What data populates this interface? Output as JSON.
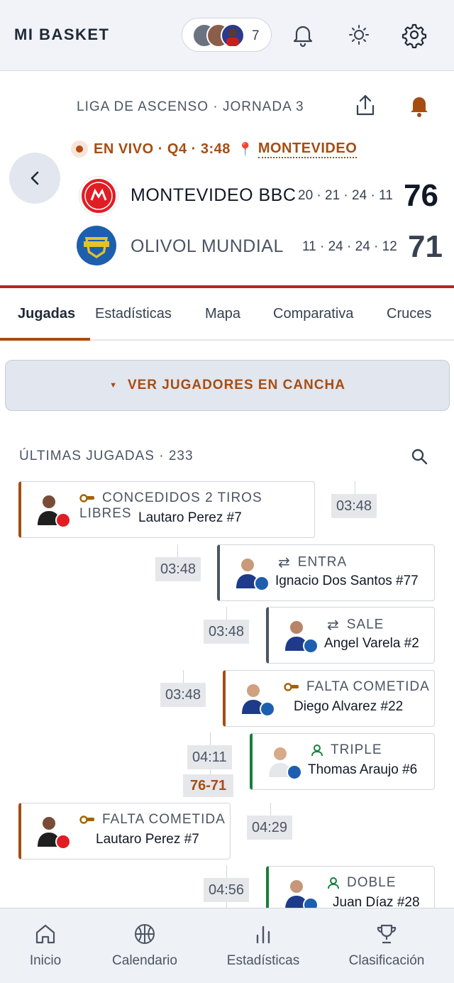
{
  "app": {
    "brand": "MI BASKET",
    "viewers_count": "7"
  },
  "header": {
    "league": "LIGA DE ASCENSO · JORNADA 3",
    "live_status": "EN VIVO · Q4 · 3:48",
    "city": "MONTEVIDEO"
  },
  "teams": [
    {
      "name": "MONTEVIDEO BBC",
      "quarters": "20 · 21 · 24 · 11",
      "score": "76",
      "color": "#e11d24"
    },
    {
      "name": "OLIVOL MUNDIAL",
      "quarters": "11 · 24 · 24 · 12",
      "score": "71",
      "color": "#1d5fae"
    }
  ],
  "tabs": [
    "Jugadas",
    "Estadísticas",
    "Mapa",
    "Comparativa",
    "Cruces"
  ],
  "oncourt_label": "VER JUGADORES EN CANCHA",
  "plays_title": "ÚLTIMAS JUGADAS · 233",
  "plays": [
    {
      "type": "CONCEDIDOS 2 TIROS LIBRES",
      "player": "Lautaro Perez #7",
      "time": "03:48"
    },
    {
      "type": "ENTRA",
      "player": "Ignacio Dos Santos #77",
      "time": "03:48"
    },
    {
      "type": "SALE",
      "player": "Angel Varela #2",
      "time": "03:48"
    },
    {
      "type": "FALTA COMETIDA",
      "player": "Diego Alvarez #22",
      "time": "03:48"
    },
    {
      "type": "TRIPLE",
      "player": "Thomas Araujo #6",
      "time": "04:11",
      "score": "76-71"
    },
    {
      "type": "FALTA COMETIDA",
      "player": "Lautaro Perez #7",
      "time": "04:29"
    },
    {
      "type": "DOBLE",
      "player": "Juan Díaz #28",
      "time": "04:56"
    }
  ],
  "nav": [
    "Inicio",
    "Calendario",
    "Estadísticas",
    "Clasificación"
  ],
  "colors": {
    "accent": "#a64d12",
    "home_red": "#b5252a",
    "score_green": "#15803d",
    "slate": "#4b5563"
  }
}
